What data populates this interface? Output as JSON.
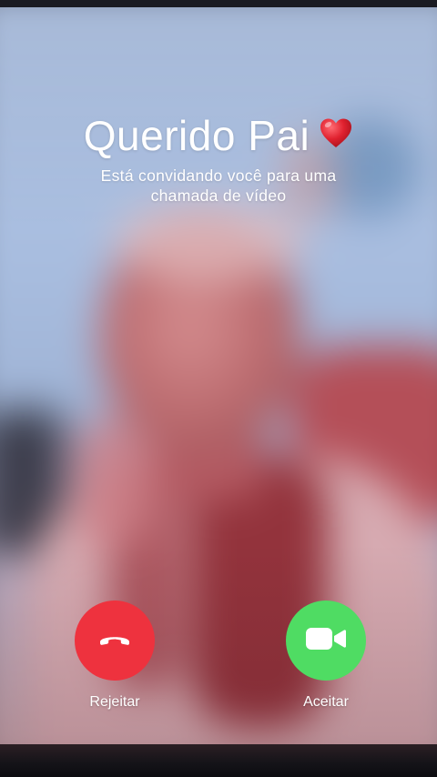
{
  "caller": {
    "name": "Querido Pai",
    "emoji_icon": "red-heart-icon",
    "subtitle": "Está convidando você para uma chamada de vídeo"
  },
  "actions": {
    "reject_label": "Rejeitar",
    "reject_icon": "hang-up-phone-icon",
    "accept_label": "Aceitar",
    "accept_icon": "video-camera-icon"
  },
  "colors": {
    "reject": "#ee323e",
    "accept": "#4fdc63",
    "heart": "#e0212f"
  }
}
